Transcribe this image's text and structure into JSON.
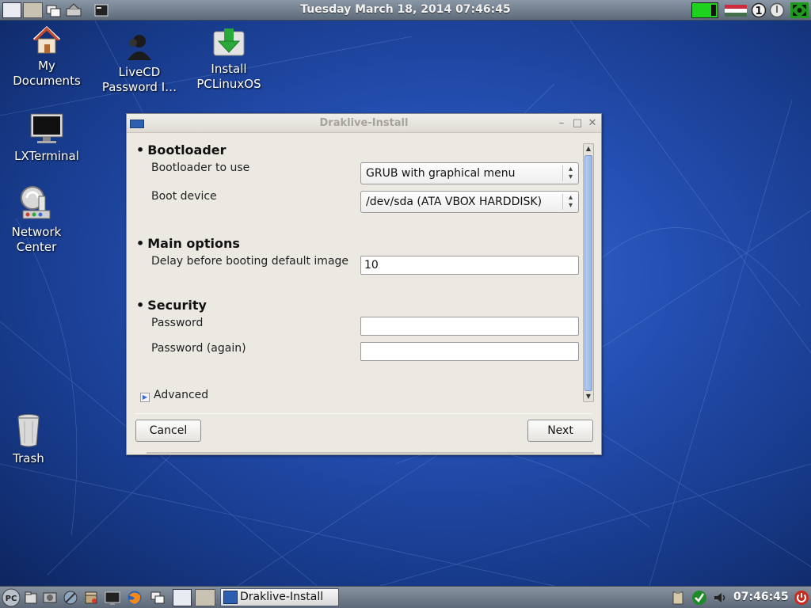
{
  "top_panel": {
    "datetime": "Tuesday March 18, 2014 07:46:45"
  },
  "desktop_icons": [
    {
      "name": "my-documents",
      "label_line1": "My",
      "label_line2": "Documents"
    },
    {
      "name": "livecd-password",
      "label_line1": "LiveCD",
      "label_line2": "Password I…"
    },
    {
      "name": "install-pclinuxos",
      "label_line1": "Install",
      "label_line2": "PCLinuxOS"
    },
    {
      "name": "lxterminal",
      "label_line1": "LXTerminal",
      "label_line2": ""
    },
    {
      "name": "network-center",
      "label_line1": "Network",
      "label_line2": "Center"
    },
    {
      "name": "trash",
      "label_line1": "Trash",
      "label_line2": ""
    }
  ],
  "window": {
    "title": "Draklive-Install",
    "sections": {
      "bootloader": {
        "title": "Bootloader",
        "bootloader_label": "Bootloader to use",
        "bootloader_value": "GRUB with graphical menu",
        "boot_device_label": "Boot device",
        "boot_device_value": "/dev/sda (ATA VBOX HARDDISK)"
      },
      "main_options": {
        "title": "Main options",
        "delay_label": "Delay before booting default image",
        "delay_value": "10"
      },
      "security": {
        "title": "Security",
        "password_label": "Password",
        "password_value": "",
        "password_again_label": "Password (again)",
        "password_again_value": ""
      }
    },
    "advanced_label": "Advanced",
    "cancel_label": "Cancel",
    "next_label": "Next"
  },
  "bottom_panel": {
    "task_label": "Draklive-Install",
    "clock": "07:46:45"
  },
  "colors": {
    "panel": "#6f7c8b",
    "wallpaper": "#2550b4",
    "window_bg": "#ece9e3",
    "accent": "#3a6ad0"
  }
}
